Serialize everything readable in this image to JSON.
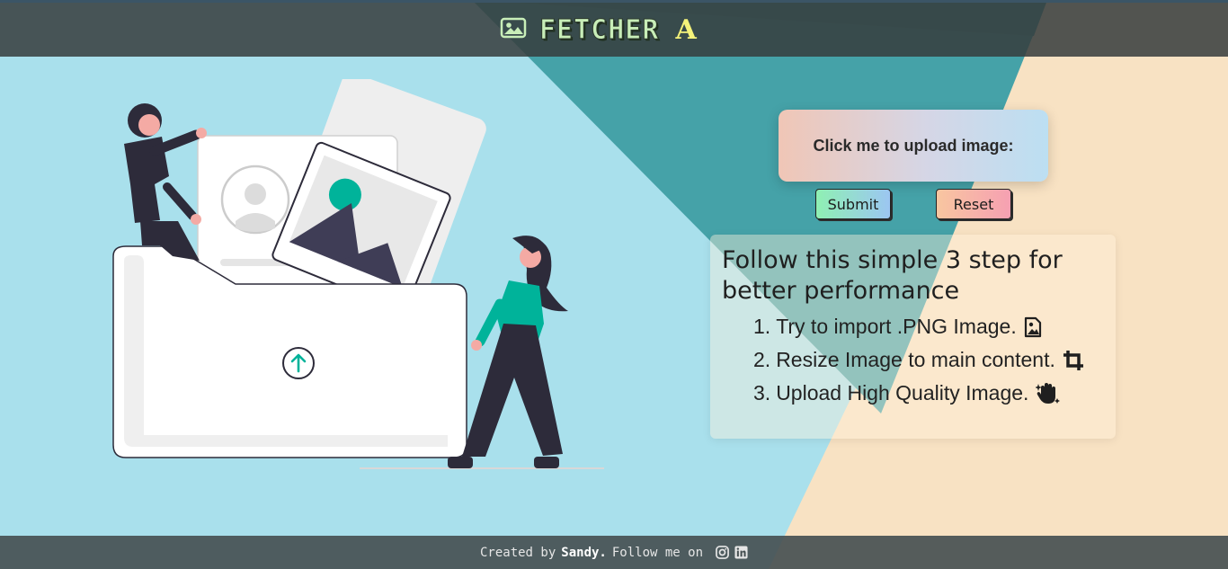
{
  "header": {
    "logo_text": "FETCHER",
    "logo_letter": "A",
    "logo_icon": "image-icon"
  },
  "upload": {
    "label": "Click me to upload image:"
  },
  "buttons": {
    "submit": "Submit",
    "reset": "Reset"
  },
  "steps": {
    "title": "Follow this simple 3 step for better performance",
    "items": [
      {
        "num": "1.",
        "text": "Try to import .PNG Image.",
        "icon": "image-file-icon"
      },
      {
        "num": "2.",
        "text": "Resize Image to main content.",
        "icon": "crop-icon"
      },
      {
        "num": "3.",
        "text": "Upload High Quality Image.",
        "icon": "sparkle-hand-icon"
      }
    ]
  },
  "footer": {
    "prefix": "Created by",
    "author": "Sandy.",
    "follow": "Follow me on",
    "social": [
      "instagram-icon",
      "linkedin-icon"
    ]
  },
  "colors": {
    "sky": "#a9e0ec",
    "teal": "#45a2a8",
    "sand": "#f8e2c3",
    "header": "#3c4242",
    "accent": "#00b39a"
  }
}
